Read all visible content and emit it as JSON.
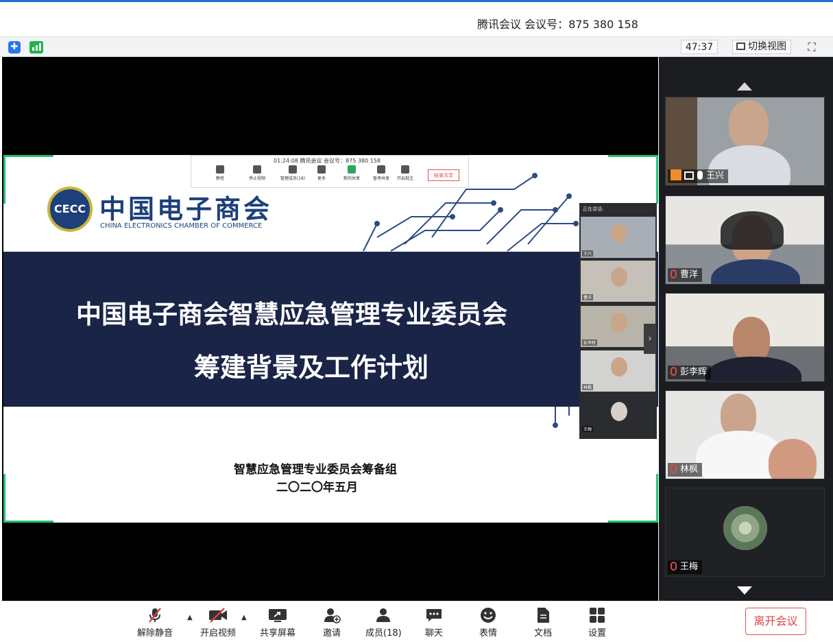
{
  "window": {
    "title": "腾讯会议 会议号：875 380 158"
  },
  "statusbar": {
    "timer": "47:37",
    "switch_view_label": "切换视图",
    "icons": [
      "shield-icon",
      "signal-icon",
      "fullscreen-icon"
    ]
  },
  "slide": {
    "logo_cn": "中国电子商会",
    "logo_en": "CHINA ELECTRONICS CHAMBER OF COMMERCE",
    "logo_mark": "CECC",
    "title_line1": "中国电子商会智慧应急管理专业委员会",
    "title_line2": "筹建背景及工作计划",
    "footer_line1": "智慧应急管理专业委员会筹备组",
    "footer_line2": "二〇二〇年五月",
    "band_color": "#192447",
    "accent_color": "#27c27a"
  },
  "share_toolbar": {
    "status": "01:24:08  腾讯会议 会议号：875 380 158",
    "items": [
      {
        "label": "静音"
      },
      {
        "label": "停止视频"
      },
      {
        "label": "管理成员(18)"
      },
      {
        "label": "更多"
      },
      {
        "label": "新的共享"
      },
      {
        "label": "暂停共享"
      },
      {
        "label": "开启批注"
      }
    ],
    "end_label": "结束共享"
  },
  "float_panel": {
    "title": "正在讲话:",
    "tiles": [
      {
        "label": "王兴"
      },
      {
        "label": "曹洋"
      },
      {
        "label": "彭李辉"
      },
      {
        "label": "林枫"
      },
      {
        "label": "王梅"
      }
    ]
  },
  "participants": [
    {
      "name": "王兴",
      "mic": "on",
      "host": true,
      "sharing": true
    },
    {
      "name": "曹洋",
      "mic": "off"
    },
    {
      "name": "彭李辉",
      "mic": "off"
    },
    {
      "name": "林枫",
      "mic": "off"
    },
    {
      "name": "王梅",
      "mic": "off",
      "video": false
    }
  ],
  "toolbar": {
    "unmute": "解除静音",
    "start_video": "开启视频",
    "share_screen": "共享屏幕",
    "invite": "邀请",
    "members": "成员(18)",
    "chat": "聊天",
    "reactions": "表情",
    "docs": "文档",
    "settings": "设置",
    "leave": "离开会议"
  },
  "colors": {
    "brand_blue": "#1f6fd6",
    "leave_red": "#e04040",
    "side_bg": "#1c1d21"
  }
}
